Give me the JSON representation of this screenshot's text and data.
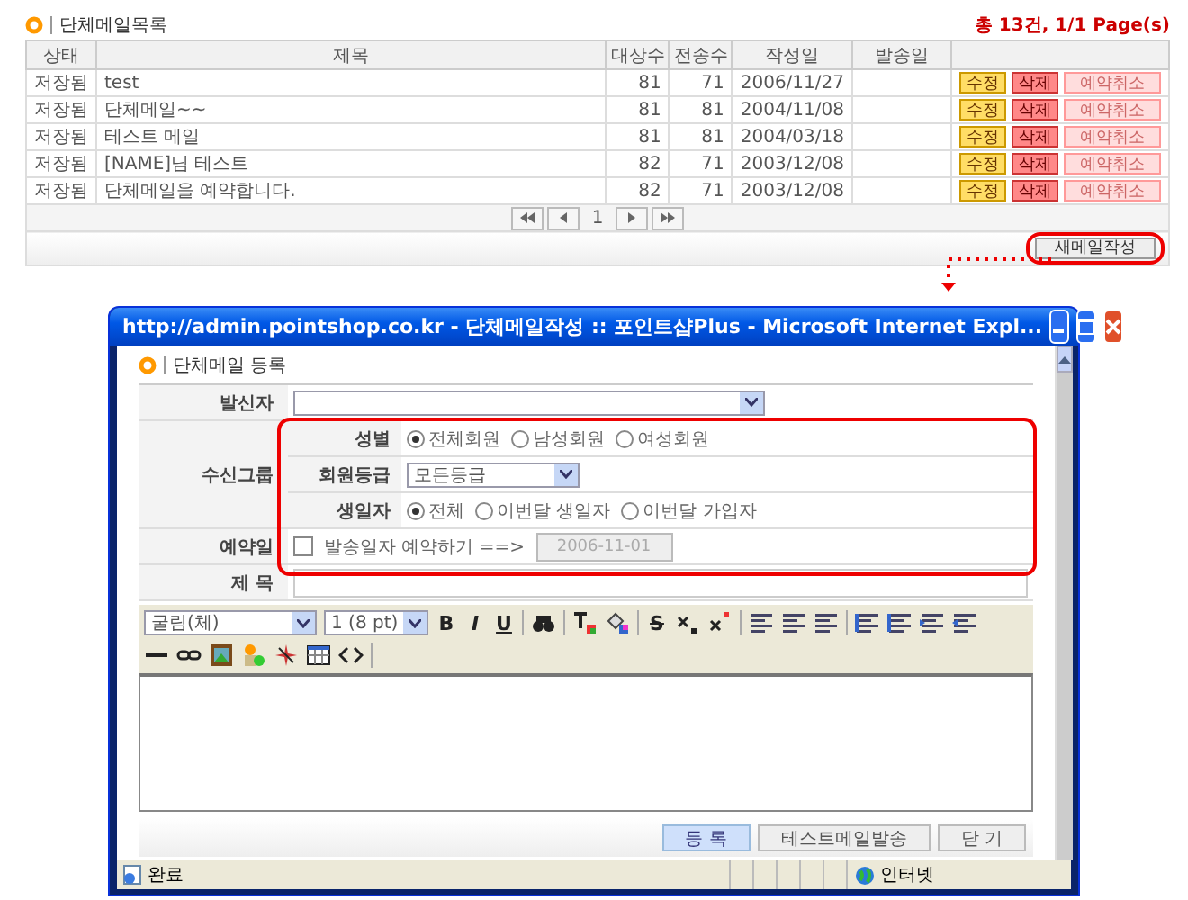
{
  "list": {
    "title": "단체메일목록",
    "summary": "총 13건, 1/1 Page(s)",
    "columns": [
      "상태",
      "제목",
      "대상수",
      "전송수",
      "작성일",
      "발송일"
    ],
    "rows": [
      {
        "status": "저장됨",
        "subject": "test",
        "targets": "81",
        "sent": "71",
        "created": "2006/11/27",
        "edit": "수정",
        "delete": "삭제",
        "cancel": {
          "label": "예약취소",
          "disabled": true
        }
      },
      {
        "status": "저장됨",
        "subject": "단체메일~~",
        "targets": "81",
        "sent": "81",
        "created": "2004/11/08",
        "edit": "수정",
        "delete": "삭제",
        "cancel": {
          "label": "예약취소",
          "disabled": true
        }
      },
      {
        "status": "저장됨",
        "subject": "테스트 메일",
        "targets": "81",
        "sent": "81",
        "created": "2004/03/18",
        "edit": "수정",
        "delete": "삭제",
        "cancel": {
          "label": "예약취소",
          "disabled": true
        }
      },
      {
        "status": "저장됨",
        "subject": "[NAME]님 테스트",
        "targets": "82",
        "sent": "71",
        "created": "2003/12/08",
        "edit": "수정",
        "delete": "삭제",
        "cancel": {
          "label": "예약취소",
          "disabled": true
        }
      },
      {
        "status": "저장됨",
        "subject": "단체메일을 예약합니다.",
        "targets": "82",
        "sent": "71",
        "created": "2003/12/08",
        "edit": "수정",
        "delete": "삭제",
        "cancel": {
          "label": "예약취소",
          "disabled": true
        }
      }
    ],
    "pagination": {
      "page": "1"
    },
    "new_button": "새메일작성"
  },
  "popup": {
    "title": "http://admin.pointshop.co.kr - 단체메일작성 :: 포인트샵Plus - Microsoft Internet Expl...",
    "heading": "단체메일 등록",
    "sender": {
      "label": "발신자"
    },
    "recipients": {
      "label": "수신그룹",
      "gender": {
        "label": "성별",
        "options": [
          {
            "label": "전체회원",
            "selected": true
          },
          {
            "label": "남성회원",
            "selected": false
          },
          {
            "label": "여성회원",
            "selected": false
          }
        ]
      },
      "grade": {
        "label": "회원등급",
        "value": "모든등급"
      },
      "birthday": {
        "label": "생일자",
        "options": [
          {
            "label": "전체",
            "selected": true
          },
          {
            "label": "이번달 생일자",
            "selected": false
          },
          {
            "label": "이번달 가입자",
            "selected": false
          }
        ]
      }
    },
    "reservation": {
      "label": "예약일",
      "checkbox": {
        "label": "발송일자 예약하기 ==>",
        "checked": false
      },
      "date": {
        "value": "2006-11-01",
        "disabled": true
      }
    },
    "subject": {
      "label": "제 목"
    },
    "editor": {
      "font": "굴림(체)",
      "size": "1 (8 pt)",
      "glyphs": [
        "B",
        "I",
        "U"
      ],
      "strike": "S"
    },
    "buttons": [
      "등 록",
      "테스트메일발송",
      "닫 기"
    ],
    "status_bar": {
      "text": "완료",
      "zone": "인터넷"
    }
  }
}
